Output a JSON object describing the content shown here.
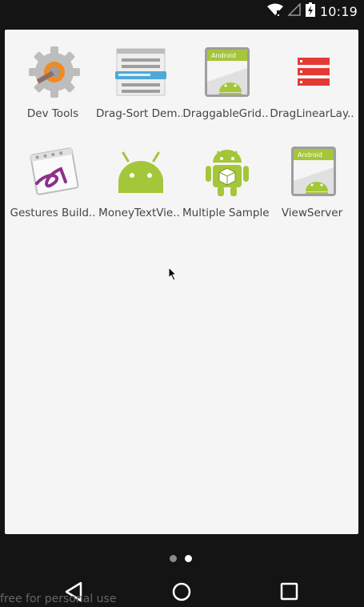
{
  "status_bar": {
    "time": "10:19",
    "icons": [
      "wifi-icon",
      "signal-icon",
      "battery-charging-icon"
    ]
  },
  "drawer": {
    "apps": [
      {
        "label": "Dev Tools",
        "icon": "gear-tools-icon"
      },
      {
        "label": "Drag-Sort Dem..",
        "icon": "list-drag-icon"
      },
      {
        "label": "DraggableGrid..",
        "icon": "android-default-icon"
      },
      {
        "label": "DragLinearLay..",
        "icon": "red-layers-icon"
      },
      {
        "label": "Gestures Build..",
        "icon": "gestures-icon"
      },
      {
        "label": "MoneyTextVie..",
        "icon": "android-head-icon"
      },
      {
        "label": "Multiple Sample",
        "icon": "android-robot-box-icon"
      },
      {
        "label": "ViewServer",
        "icon": "android-default-icon"
      }
    ]
  },
  "pager": {
    "pages": 2,
    "current_page": 2
  },
  "nav_bar": {
    "buttons": [
      "back-icon",
      "home-icon",
      "recents-icon"
    ]
  },
  "watermark": "free for personal use",
  "colors": {
    "background": "#141414",
    "drawer": "#f5f5f5",
    "android_green": "#a4c639",
    "red_icon": "#e53935"
  }
}
